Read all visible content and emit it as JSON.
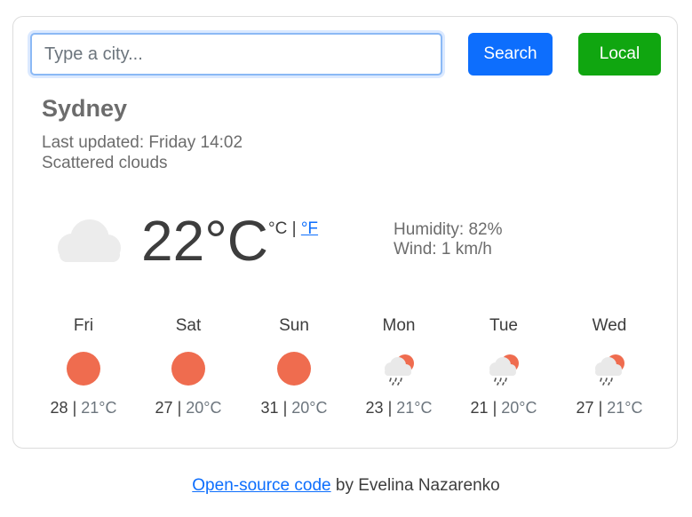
{
  "search": {
    "placeholder": "Type a city...",
    "value": ""
  },
  "buttons": {
    "search_label": "Search",
    "local_label": "Local"
  },
  "current": {
    "city": "Sydney",
    "last_updated": "Last updated: Friday 14:02",
    "description": "Scattered clouds",
    "temperature": "22°C",
    "unit_celsius": "°C",
    "unit_separator": "|",
    "unit_fahrenheit": "°F",
    "humidity": "Humidity: 82%",
    "wind": "Wind: 1 km/h",
    "icon": "cloud-icon"
  },
  "forecast": [
    {
      "day": "Fri",
      "icon": "sun-icon",
      "high": "28",
      "low": "21°C"
    },
    {
      "day": "Sat",
      "icon": "sun-icon",
      "high": "27",
      "low": "20°C"
    },
    {
      "day": "Sun",
      "icon": "sun-icon",
      "high": "31",
      "low": "20°C"
    },
    {
      "day": "Mon",
      "icon": "rain-sun-icon",
      "high": "23",
      "low": "21°C"
    },
    {
      "day": "Tue",
      "icon": "rain-sun-icon",
      "high": "21",
      "low": "20°C"
    },
    {
      "day": "Wed",
      "icon": "rain-sun-icon",
      "high": "27",
      "low": "21°C"
    }
  ],
  "footer": {
    "link_text": "Open-source code",
    "author_text": " by Evelina Nazarenko"
  },
  "colors": {
    "primary": "#0d6efd",
    "success": "#10a610",
    "sun": "#ef6c4f"
  }
}
